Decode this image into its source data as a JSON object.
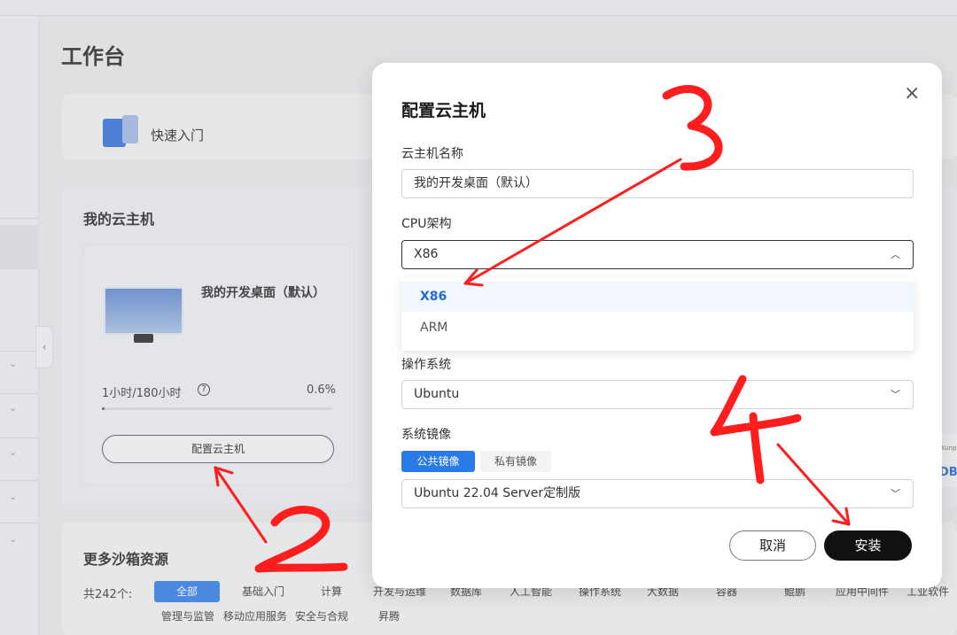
{
  "page": {
    "title": "工作台"
  },
  "quick_start": {
    "label": "快速入门"
  },
  "my_cloud": {
    "title": "我的云主机",
    "vm_name": "我的开发桌面（默认）",
    "usage": "1小时/180小时",
    "help_icon": "?",
    "percent": "0.6%",
    "usage_fraction": 0.006,
    "config_button": "配置云主机"
  },
  "side_card": {
    "tiny_text": "Kunp",
    "dark_text": "DB"
  },
  "more_resources": {
    "title": "更多沙箱资源",
    "count": "共242个:",
    "tags_row1": [
      "全部",
      "基础入门",
      "计算",
      "开发与运维",
      "数据库",
      "人工智能",
      "操作系统",
      "大数据",
      "容器",
      "鲲鹏",
      "应用中间件",
      "工业软件"
    ],
    "tags_row2": [
      "管理与监管",
      "移动应用服务",
      "安全与合规",
      "昇腾"
    ]
  },
  "modal": {
    "title": "配置云主机",
    "close_icon": "×",
    "name_label": "云主机名称",
    "name_value": "我的开发桌面（默认）",
    "cpu_label": "CPU架构",
    "cpu_value": "X86",
    "cpu_options": [
      "X86",
      "ARM"
    ],
    "os_label": "操作系统",
    "os_value": "Ubuntu",
    "image_label": "系统镜像",
    "image_tabs": [
      "公共镜像",
      "私有镜像"
    ],
    "image_value": "Ubuntu 22.04 Server定制版",
    "cancel_label": "取消",
    "install_label": "安装"
  },
  "annotations": {
    "n2": "2",
    "n3": "3",
    "n4": "4",
    "color": "#ff1d1d"
  },
  "icons": {
    "chevron_up": "chevron-up-icon",
    "chevron_down": "chevron-down-icon",
    "close": "close-icon",
    "help": "question-circle-icon"
  }
}
